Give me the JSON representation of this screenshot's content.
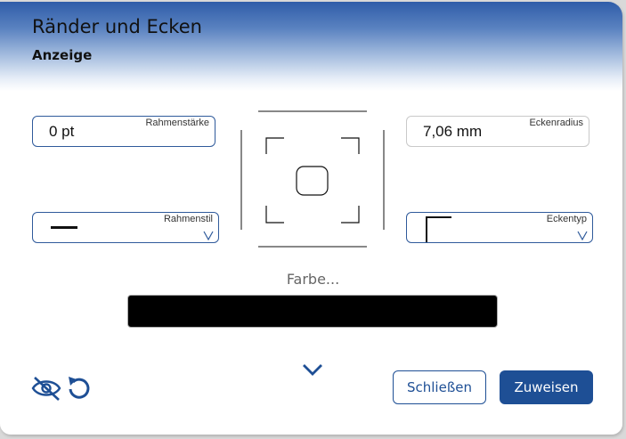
{
  "dialog": {
    "title": "Ränder und Ecken",
    "subtitle": "Anzeige"
  },
  "fields": {
    "border_thickness": {
      "label": "Rahmenstärke",
      "value": "0 pt"
    },
    "corner_radius": {
      "label": "Eckenradius",
      "value": "7,06 mm"
    },
    "border_style": {
      "label": "Rahmenstil",
      "icon": "solid-line-icon"
    },
    "corner_type": {
      "label": "Eckentyp",
      "icon": "square-corner-icon"
    }
  },
  "color": {
    "label": "Farbe...",
    "value": "#000000"
  },
  "toolbar": {
    "visibility_icon": "eye-off-icon",
    "reset_icon": "undo-icon",
    "expand_icon": "chevron-down-icon"
  },
  "buttons": {
    "close_label": "Schließen",
    "apply_label": "Zuweisen"
  },
  "colors": {
    "accent": "#1e4f95",
    "header_gradient_top": "#2f5da9"
  }
}
